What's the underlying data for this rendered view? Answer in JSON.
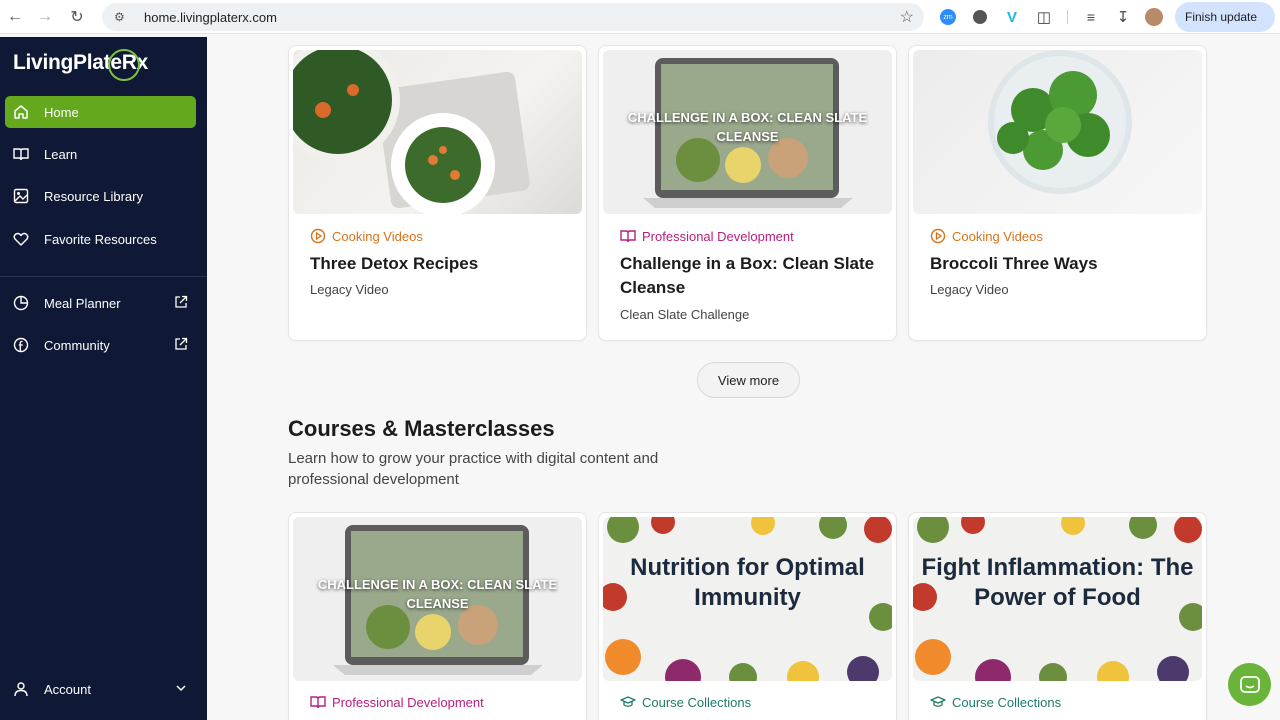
{
  "browser": {
    "url": "home.livingplaterx.com",
    "finish_update": "Finish update",
    "extensions": [
      "zm",
      "ext-circle",
      "V",
      "puzzle-icon",
      "media-list-icon",
      "download-icon",
      "avatar"
    ]
  },
  "sidebar": {
    "logo": "LivingPlateRx",
    "items": [
      {
        "label": "Home",
        "icon": "home-icon",
        "active": true
      },
      {
        "label": "Learn",
        "icon": "book-icon"
      },
      {
        "label": "Resource Library",
        "icon": "image-icon"
      },
      {
        "label": "Favorite Resources",
        "icon": "heart-icon"
      }
    ],
    "external": [
      {
        "label": "Meal Planner",
        "icon": "pie-chart-icon"
      },
      {
        "label": "Community",
        "icon": "facebook-icon"
      }
    ],
    "account": "Account"
  },
  "top_cards": [
    {
      "category": "Cooking Videos",
      "title": "Three Detox Recipes",
      "subtitle": "Legacy Video"
    },
    {
      "category": "Professional Development",
      "title": "Challenge in a Box: Clean Slate Cleanse",
      "subtitle": "Clean Slate Challenge",
      "thumb_text": "CHALLENGE IN A BOX: CLEAN SLATE CLEANSE"
    },
    {
      "category": "Cooking Videos",
      "title": "Broccoli Three Ways",
      "subtitle": "Legacy Video"
    }
  ],
  "view_more": "View more",
  "courses": {
    "title": "Courses & Masterclasses",
    "description": "Learn how to grow your practice with digital content and professional development",
    "cards": [
      {
        "category": "Professional Development",
        "thumb_text": "CHALLENGE IN A BOX: CLEAN SLATE CLEANSE"
      },
      {
        "category": "Course Collections",
        "thumb_text": "Nutrition for Optimal Immunity"
      },
      {
        "category": "Course Collections",
        "thumb_text": "Fight Inflammation: The Power of Food"
      }
    ]
  },
  "colors": {
    "sidebar_bg": "#0f1834",
    "active_green": "#63a81d",
    "cooking_orange": "#d4731c",
    "prof_dev_pink": "#b5207e",
    "course_teal": "#1f7a6b"
  }
}
